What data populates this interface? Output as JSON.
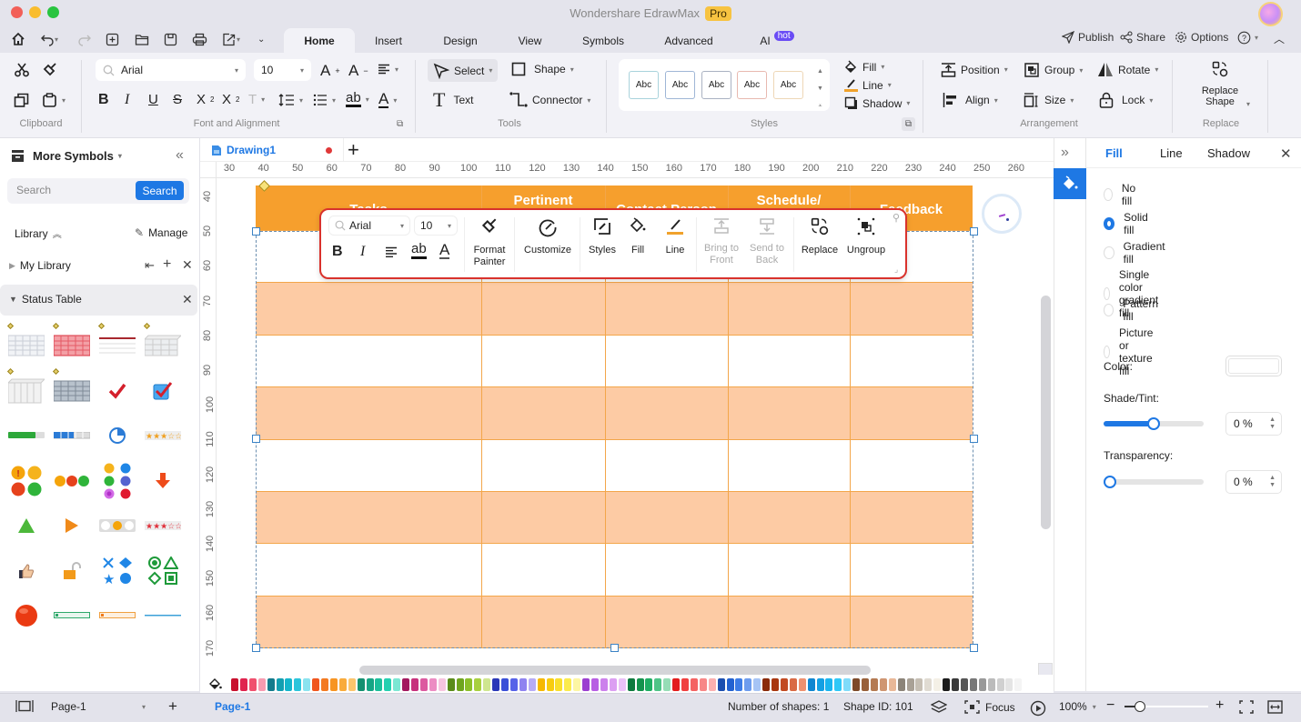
{
  "window": {
    "title": "Wondershare EdrawMax",
    "badge": "Pro"
  },
  "quick_access": [
    "home-icon",
    "undo-icon",
    "redo-icon",
    "new-icon",
    "open-folder-icon",
    "save-icon",
    "print-icon",
    "export-icon",
    "more-icon"
  ],
  "tabs": [
    {
      "label": "Home",
      "active": true
    },
    {
      "label": "Insert"
    },
    {
      "label": "Design"
    },
    {
      "label": "View"
    },
    {
      "label": "Symbols"
    },
    {
      "label": "Advanced"
    },
    {
      "label": "AI",
      "badge": "hot"
    }
  ],
  "top_right": {
    "publish": "Publish",
    "share": "Share",
    "options": "Options"
  },
  "ribbon": {
    "clipboard": {
      "label": "Clipboard"
    },
    "font": {
      "label": "Font and Alignment",
      "font_name": "Arial",
      "font_size": "10"
    },
    "tools": {
      "label": "Tools",
      "select": "Select",
      "shape": "Shape",
      "text": "Text",
      "connector": "Connector"
    },
    "styles": {
      "label": "Styles",
      "swatches": [
        "Abc",
        "Abc",
        "Abc",
        "Abc",
        "Abc"
      ],
      "swatch_borders": [
        "#a9d3dc",
        "#9fb6d6",
        "#aab2c2",
        "#e8b9b0",
        "#eed7b6"
      ],
      "fill": "Fill",
      "line": "Line",
      "shadow": "Shadow"
    },
    "arrangement": {
      "label": "Arrangement",
      "position": "Position",
      "group": "Group",
      "rotate": "Rotate",
      "align": "Align",
      "size": "Size",
      "lock": "Lock"
    },
    "replace": {
      "label": "Replace",
      "replace_shape_l1": "Replace",
      "replace_shape_l2": "Shape"
    }
  },
  "left_panel": {
    "title": "More Symbols",
    "search_placeholder": "Search",
    "search_button": "Search",
    "library_label": "Library",
    "manage": "Manage",
    "my_library": "My Library",
    "status_table": "Status Table",
    "symbols": [
      "grid-table",
      "red-grid-table",
      "header-line-table",
      "3d-table",
      "3d-gray-table",
      "dark-grid-table",
      "red-checkmark",
      "checked-checkbox",
      "green-progress-bar",
      "blue-segment-bar",
      "pie-progress",
      "orange-star-rating",
      "four-status-lights",
      "three-traffic-lights",
      "six-color-dots",
      "red-down-arrow",
      "green-triangle",
      "orange-play-arrow",
      "slider-toggle",
      "red-star-rating",
      "thumbs-up",
      "orange-unlock",
      "blue-shape-set",
      "green-shape-set",
      "red-ball",
      "green-bar",
      "orange-bar",
      "blue-line"
    ]
  },
  "document": {
    "tab_name": "Drawing1",
    "unsaved": true,
    "ruler_h": [
      "30",
      "40",
      "50",
      "60",
      "70",
      "80",
      "90",
      "100",
      "110",
      "120",
      "130",
      "140",
      "150",
      "160",
      "170",
      "180",
      "190",
      "200",
      "210",
      "220",
      "230",
      "240",
      "250",
      "260"
    ],
    "ruler_v": [
      "40",
      "50",
      "60",
      "70",
      "80",
      "90",
      "100",
      "110",
      "120",
      "130",
      "140",
      "150",
      "160",
      "170"
    ]
  },
  "status_table": {
    "headers": [
      "Tasks",
      "Pertinent",
      "Contact Person",
      "Schedule/",
      "Feedback"
    ],
    "header_color": "#f69f2d",
    "band_color": "#fdcba4",
    "rows": 8
  },
  "floating_toolbar": {
    "font_name": "Arial",
    "font_size": "10",
    "format_painter_l1": "Format",
    "format_painter_l2": "Painter",
    "customize": "Customize",
    "styles": "Styles",
    "fill": "Fill",
    "line": "Line",
    "bring_front_l1": "Bring to",
    "bring_front_l2": "Front",
    "send_back_l1": "Send to",
    "send_back_l2": "Back",
    "replace": "Replace",
    "ungroup": "Ungroup"
  },
  "palette": [
    "#c8102e",
    "#e0234e",
    "#f0506e",
    "#f79bb0",
    "#137b8c",
    "#129fb1",
    "#14b6cc",
    "#2bc5db",
    "#8ae3ef",
    "#f0561f",
    "#f37a22",
    "#f79523",
    "#f9ab3b",
    "#fbc56d",
    "#139070",
    "#16a584",
    "#1cbf9b",
    "#25d0b0",
    "#7be7d3",
    "#a3185f",
    "#c7317c",
    "#dc5aa0",
    "#ec8cc3",
    "#f7c5e0",
    "#5a8c1a",
    "#6fa51e",
    "#8cbf2a",
    "#a8d03f",
    "#cfe68f",
    "#2a37b8",
    "#3a4fd8",
    "#5762e8",
    "#8f83f0",
    "#b7acf6",
    "#f6b800",
    "#f7cc10",
    "#f9df2c",
    "#fbeb4d",
    "#fdf6a3",
    "#9b3fd0",
    "#b75ee3",
    "#cc80ec",
    "#dc9ff2",
    "#ebc2f7",
    "#0e7a3e",
    "#14934d",
    "#1fae63",
    "#4ec487",
    "#96ddb6",
    "#e31d1d",
    "#f03f3f",
    "#f46363",
    "#f78787",
    "#fab0b0",
    "#1b4fb0",
    "#2362d1",
    "#3d7ce6",
    "#6d9cee",
    "#a6c4f5",
    "#8a2a0a",
    "#a8360f",
    "#c24a22",
    "#d96a45",
    "#ee9170",
    "#0f86d1",
    "#14a0e3",
    "#1ab5ef",
    "#2fc8f7",
    "#7fdcfa",
    "#7d4a2a",
    "#98603a",
    "#b47a52",
    "#cf9672",
    "#e9b898",
    "#8c8479",
    "#a9a196",
    "#c6bfb4",
    "#e0dbd2",
    "#f4f0e6",
    "#1c1c1c",
    "#3a3a3a",
    "#555555",
    "#777777",
    "#999999",
    "#bbbbbb",
    "#d0d0d0",
    "#e4e4e4",
    "#f4f4f4"
  ],
  "right_panel": {
    "tabs": [
      "Fill",
      "Line",
      "Shadow"
    ],
    "active_tab": "Fill",
    "options": [
      {
        "label": "No fill",
        "selected": false
      },
      {
        "label": "Solid fill",
        "selected": true
      },
      {
        "label": "Gradient fill",
        "selected": false
      },
      {
        "label": "Single color gradient fill",
        "selected": false
      },
      {
        "label": "Pattern fill",
        "selected": false
      },
      {
        "label": "Picture or texture fill",
        "selected": false
      }
    ],
    "color_label": "Color:",
    "color_value": "#ffffff",
    "shade_label": "Shade/Tint:",
    "shade_slider_fraction": 0.5,
    "shade_value": "0 %",
    "transparency_label": "Transparency:",
    "transparency_slider_fraction": 0.0,
    "transparency_value": "0 %"
  },
  "status_bar": {
    "page_select": "Page-1",
    "page_tab": "Page-1",
    "num_shapes": "Number of shapes: 1",
    "shape_id": "Shape ID: 101",
    "focus": "Focus",
    "zoom": "100%",
    "zoom_fraction": 0.18
  }
}
